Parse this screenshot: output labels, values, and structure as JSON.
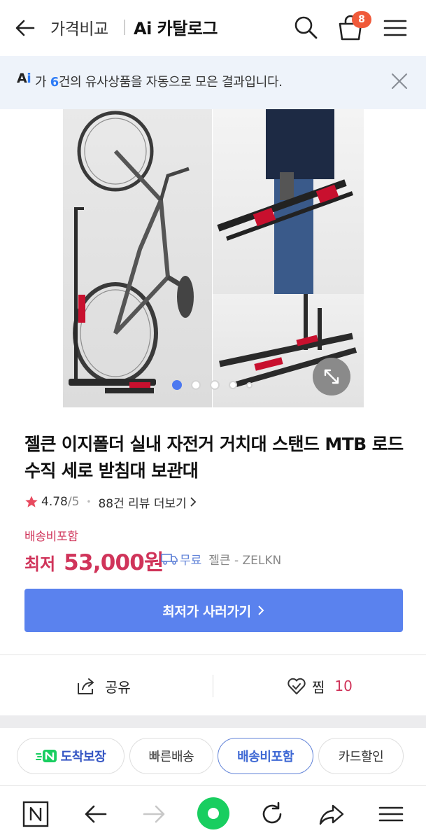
{
  "header": {
    "breadcrumb": "가격비교",
    "title": "Ai 카탈로그",
    "cart_count": "8"
  },
  "notice": {
    "ai_label_a": "A",
    "ai_label_i": "i",
    "text_prefix": "가 ",
    "count": "6",
    "text_suffix": "건의 유사상품을 자동으로 모은 결과입니다."
  },
  "gallery": {
    "slide_count": 5,
    "active_slide": 1
  },
  "product": {
    "title": "젤큰 이지폴더 실내 자전거 거치대 스탠드 MTB 로드 수직 세로 받침대 보관대",
    "rating": "4.78",
    "rating_max": "/5",
    "reviews": "88건 리뷰 더보기",
    "shipping_included": "배송비포함",
    "price_label": "최저",
    "price": "53,000원",
    "delivery_free": "무료",
    "seller": "젤큰 - ZELKN",
    "buy_button": "최저가 사러가기"
  },
  "actions": {
    "share": "공유",
    "wish": "찜",
    "wish_count": "10"
  },
  "chips": [
    {
      "label": "도착보장"
    },
    {
      "label": "빠른배송"
    },
    {
      "label": "배송비포함"
    },
    {
      "label": "카드할인"
    }
  ],
  "colors": {
    "accent_blue": "#5a82ee",
    "price_red": "#d0345a",
    "badge_orange": "#f05a3a",
    "notice_bg": "#eef3fa",
    "naver_green": "#19ce60"
  }
}
